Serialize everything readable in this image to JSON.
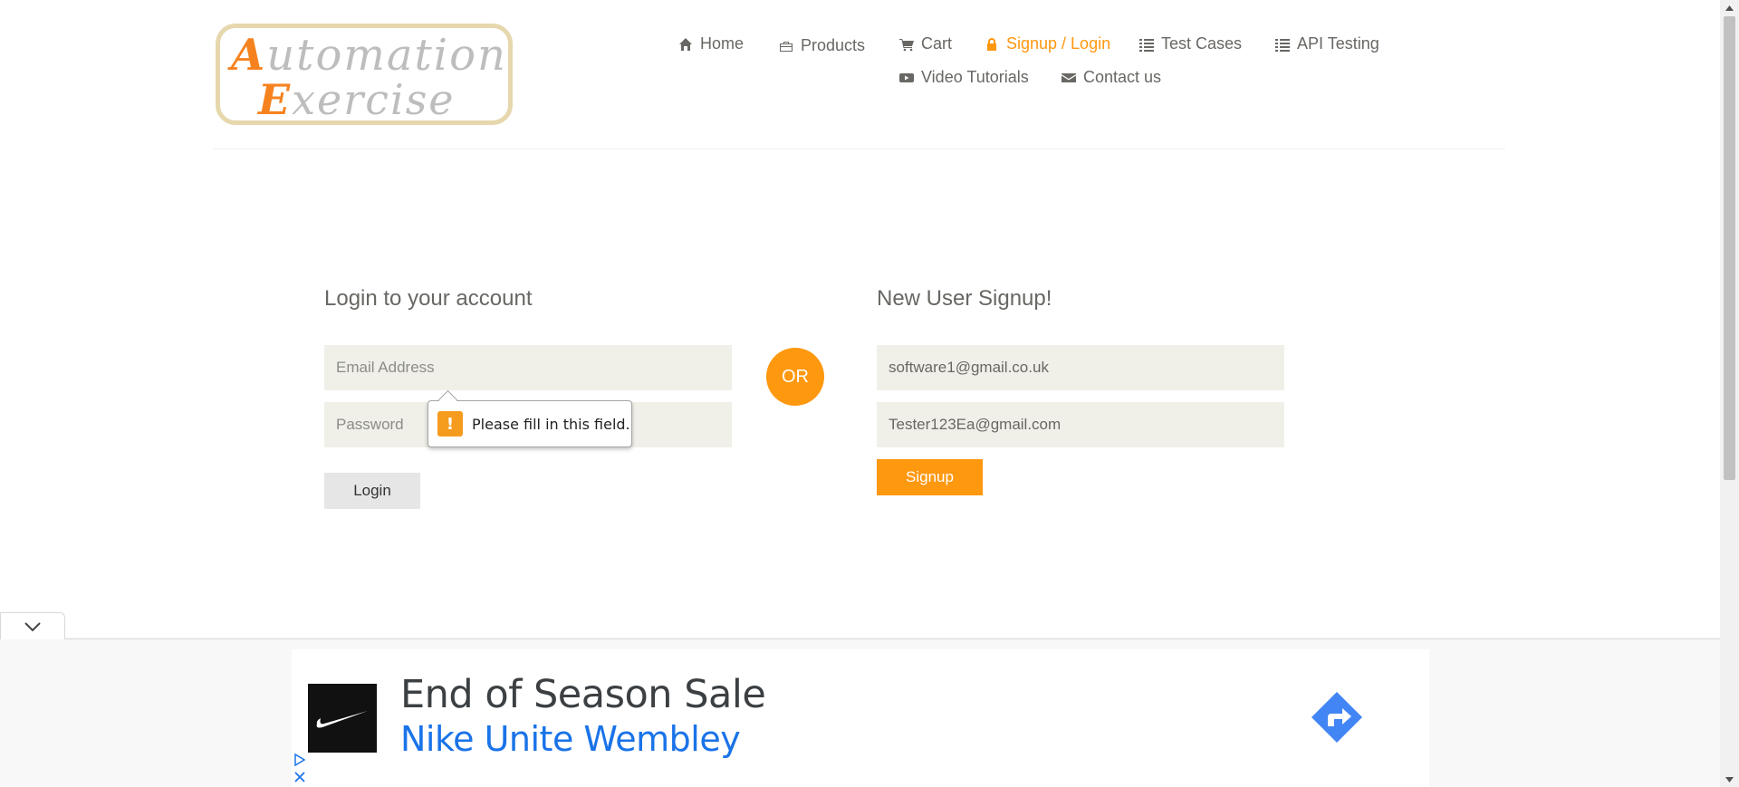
{
  "header": {
    "logo_line1": {
      "cap": "A",
      "rest": "utomation"
    },
    "logo_line2": {
      "cap": "E",
      "rest": "xercise"
    },
    "nav": [
      {
        "label": "Home",
        "icon": "home-icon"
      },
      {
        "label": "Products",
        "icon": "briefcase-icon"
      },
      {
        "label": "Cart",
        "icon": "cart-icon"
      },
      {
        "label": "Signup / Login",
        "icon": "lock-icon",
        "active": true
      },
      {
        "label": "Test Cases",
        "icon": "list-icon"
      },
      {
        "label": "API Testing",
        "icon": "list-icon"
      },
      {
        "label": "Video Tutorials",
        "icon": "youtube-icon"
      },
      {
        "label": "Contact us",
        "icon": "envelope-icon"
      }
    ]
  },
  "login": {
    "title": "Login to your account",
    "email_placeholder": "Email Address",
    "password_placeholder": "Password",
    "button": "Login"
  },
  "or_label": "OR",
  "signup": {
    "title": "New User Signup!",
    "name_value": "software1@gmail.co.uk",
    "email_value": "Tester123Ea@gmail.com",
    "button": "Signup"
  },
  "tooltip": {
    "icon": "!",
    "text": "Please fill in this field."
  },
  "ad": {
    "headline": "End of Season Sale",
    "subline": "Nike Unite Wembley"
  },
  "colors": {
    "accent": "#fe980f",
    "field_bg": "#f0f0e9",
    "text": "#696763",
    "ad_link": "#1a73e8"
  }
}
